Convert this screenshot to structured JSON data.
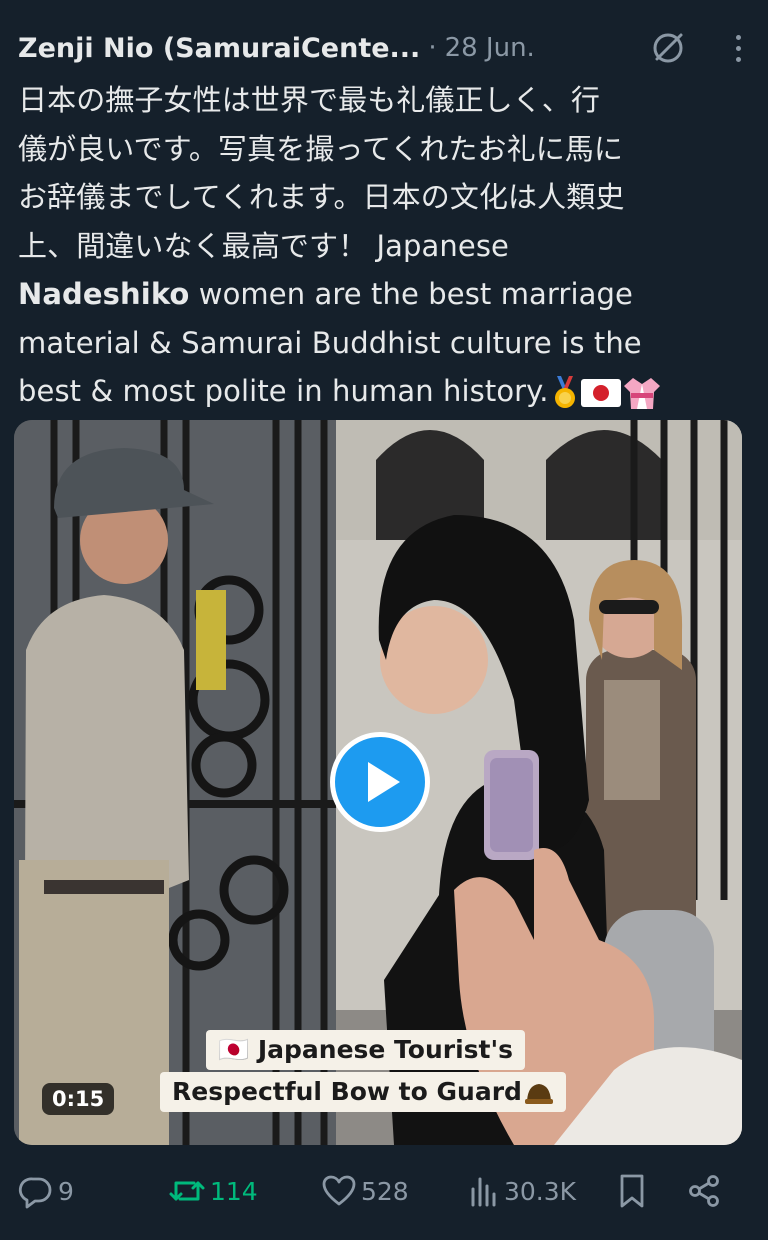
{
  "tweet": {
    "author": "Zenji Nio (SamuraiCente...",
    "separator": "·",
    "date": "28 Jun.",
    "text_lines": [
      "日本の撫子女性は世界で最も礼儀正しく、行",
      "儀が良いです。写真を撮ってくれたお礼に馬に",
      "お辞儀までしてくれます。日本の文化は人類史",
      "上、間違いなく最高です！ Japanese"
    ],
    "bold_word": "Nadeshiko",
    "line5_rest": " women are the best marriage",
    "line6": "material & Samurai Buddhist culture is the",
    "line7": "best & most polite in human history."
  },
  "icons": {
    "grok": "grok-slash-circle-icon",
    "more": "more-vertical-icon",
    "emojis": [
      "medal-icon",
      "japan-flag-icon",
      "kimono-icon"
    ]
  },
  "media": {
    "caption_line1": "🇯🇵 Japanese Tourist's",
    "caption_line2": "Respectful Bow to Guard",
    "duration": "0:15",
    "play_icon": "play-icon"
  },
  "actions": {
    "replies": "9",
    "retweets": "114",
    "likes": "528",
    "views": "30.3K"
  },
  "colors": {
    "background": "#15202b",
    "text": "#e7e9ea",
    "muted": "#8b98a5",
    "retweet_active": "#00ba7c",
    "play_button": "#1d9bf0"
  }
}
